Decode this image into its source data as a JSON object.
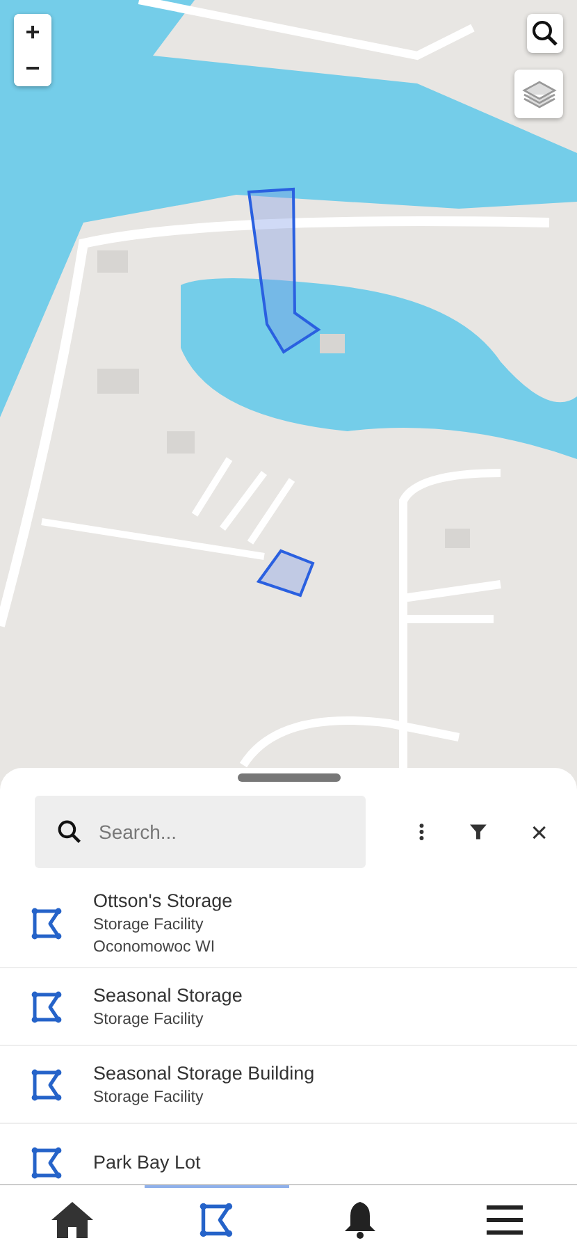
{
  "map": {
    "kind": "picture",
    "zoom_in": "+",
    "zoom_out": "−"
  },
  "search": {
    "placeholder": "Search..."
  },
  "results": [
    {
      "title": "Ottson's Storage",
      "lines": [
        "Storage Facility",
        "Oconomowoc WI"
      ]
    },
    {
      "title": "Seasonal Storage",
      "lines": [
        "Storage Facility"
      ]
    },
    {
      "title": "Seasonal Storage Building",
      "lines": [
        "Storage Facility"
      ]
    },
    {
      "title": "Park Bay Lot"
    }
  ],
  "nav": [
    {
      "kind": "home",
      "selected": false
    },
    {
      "kind": "features",
      "selected": true
    },
    {
      "kind": "alerts",
      "selected": false
    },
    {
      "kind": "menu",
      "selected": false
    }
  ]
}
